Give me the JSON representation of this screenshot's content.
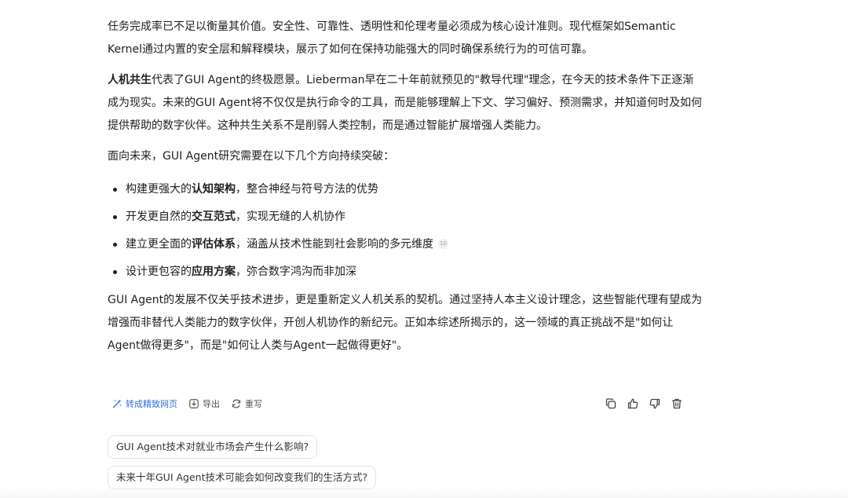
{
  "article": {
    "p1": "任务完成率已不足以衡量其价值。安全性、可靠性、透明性和伦理考量必须成为核心设计准则。现代框架如Semantic Kernel通过内置的安全层和解释模块，展示了如何在保持功能强大的同时确保系统行为的可信可靠。",
    "p2_bold": "人机共生",
    "p2_rest": "代表了GUI Agent的终极愿景。Lieberman早在二十年前就预见的\"教导代理\"理念，在今天的技术条件下正逐渐成为现实。未来的GUI Agent将不仅仅是执行命令的工具，而是能够理解上下文、学习偏好、预测需求，并知道何时及如何提供帮助的数字伙伴。这种共生关系不是削弱人类控制，而是通过智能扩展增强人类能力。",
    "p3": "面向未来，GUI Agent研究需要在以下几个方向持续突破：",
    "bullets": [
      {
        "pre": "构建更强大的",
        "bold": "认知架构",
        "post": "，整合神经与符号方法的优势"
      },
      {
        "pre": "开发更自然的",
        "bold": "交互范式",
        "post": "，实现无缝的人机协作"
      },
      {
        "pre": "建立更全面的",
        "bold": "评估体系",
        "post": "，涵盖从技术性能到社会影响的多元维度",
        "cite": "10"
      },
      {
        "pre": "设计更包容的",
        "bold": "应用方案",
        "post": "，弥合数字鸿沟而非加深"
      }
    ],
    "p4": "GUI Agent的发展不仅关乎技术进步，更是重新定义人机关系的契机。通过坚持人本主义设计理念，这些智能代理有望成为增强而非替代人类能力的数字伙伴，开创人机协作的新纪元。正如本综述所揭示的，这一领域的真正挑战不是\"如何让Agent做得更多\"，而是\"如何让人类与Agent一起做得更好\"。"
  },
  "toolbar": {
    "convert_label": "转成精致网页",
    "export_label": "导出",
    "rewrite_label": "重写",
    "accent_color": "#2f6fe0"
  },
  "suggestions": [
    "GUI Agent技术对就业市场会产生什么影响?",
    "未来十年GUI Agent技术可能会如何改变我们的生活方式?"
  ]
}
